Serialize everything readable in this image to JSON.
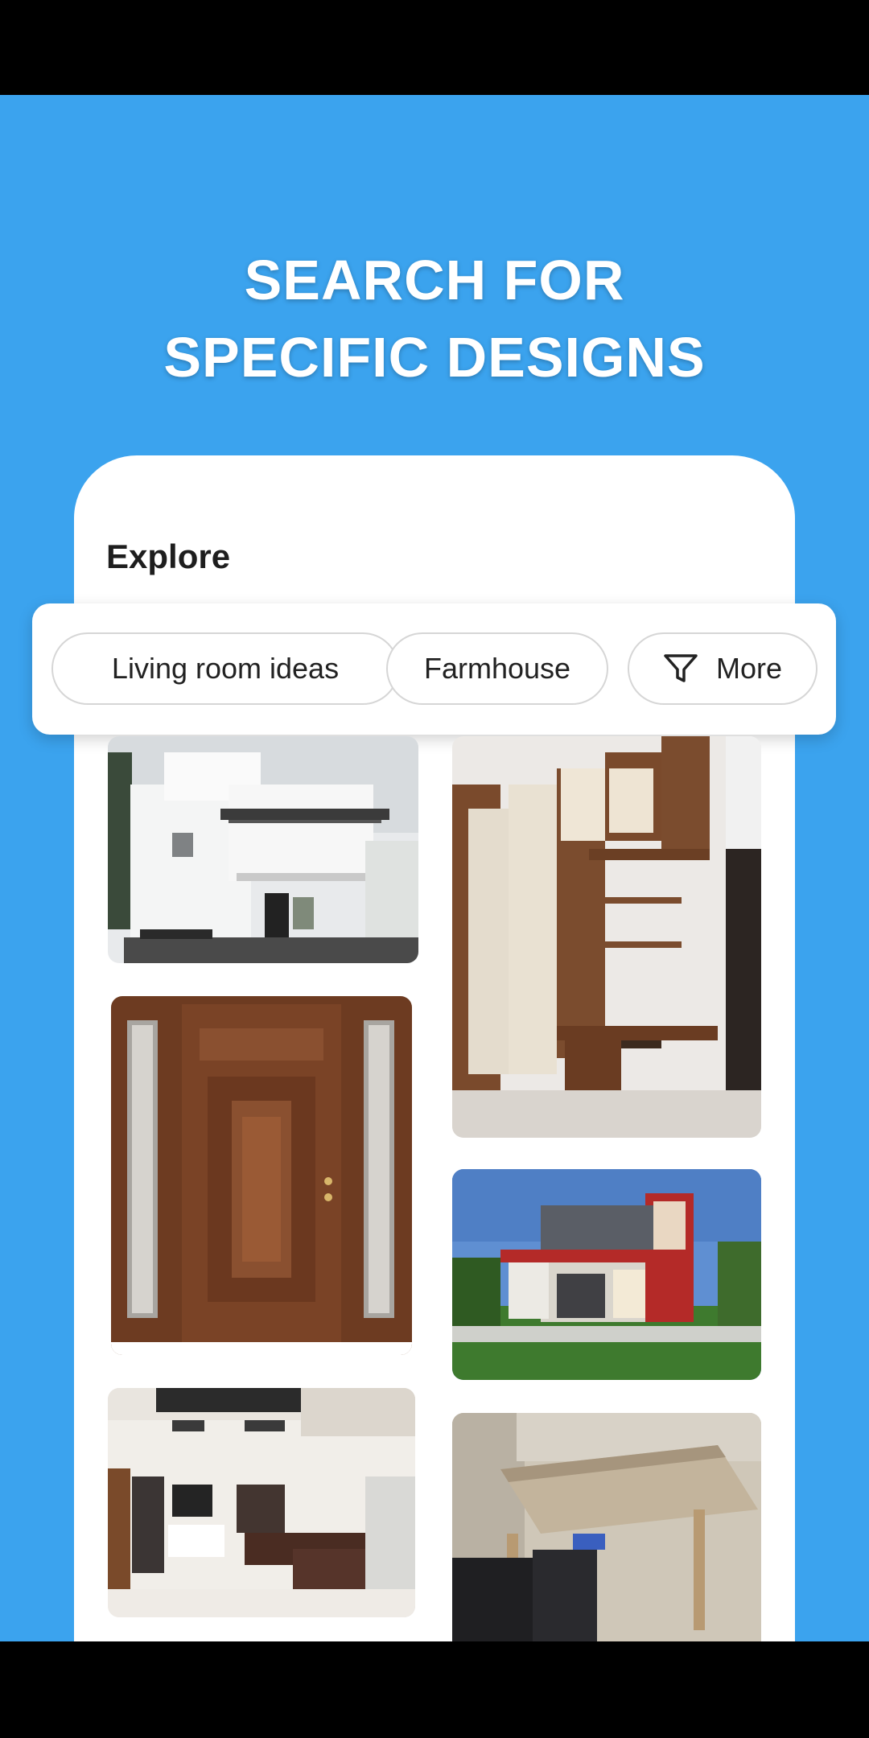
{
  "headline": {
    "line1": "SEARCH FOR",
    "line2": "SPECIFIC DESIGNS"
  },
  "explore": {
    "title": "Explore"
  },
  "chips": [
    {
      "label": "Living room ideas"
    },
    {
      "label": "Farmhouse"
    },
    {
      "label": "More",
      "icon": "filter-icon"
    }
  ],
  "colors": {
    "background": "#3ba3ee",
    "card": "#ffffff",
    "text": "#1e1e1e"
  },
  "grid": {
    "images": [
      {
        "name": "white-house-image"
      },
      {
        "name": "wardrobe-image"
      },
      {
        "name": "wooden-door-image"
      },
      {
        "name": "modern-house-image"
      },
      {
        "name": "living-room-image"
      },
      {
        "name": "wooden-table-image"
      }
    ]
  }
}
